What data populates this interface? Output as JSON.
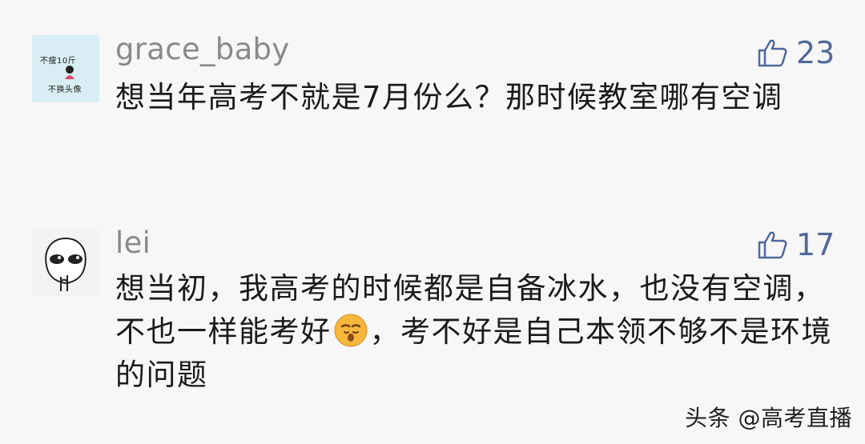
{
  "comments": [
    {
      "username": "grace_baby",
      "likes": "23",
      "avatar_text_line1": "不瘦10斤",
      "avatar_text_line2": "不换头像",
      "content": "想当年高考不就是7月份么？那时候教室哪有空调"
    },
    {
      "username": "lei",
      "likes": "17",
      "content_part1": "想当初，我高考的时候都是自备冰水，也没有空调，不也一样能考好",
      "content_part2": "，考不好是自己本领不够不是环境的问题",
      "emoji": "sleepy-face-emoji"
    }
  ],
  "watermark": "头条 @高考直播",
  "colors": {
    "background": "#f7f7f7",
    "username": "#8a8a8a",
    "like": "#506999",
    "text": "#1b1b1b"
  }
}
